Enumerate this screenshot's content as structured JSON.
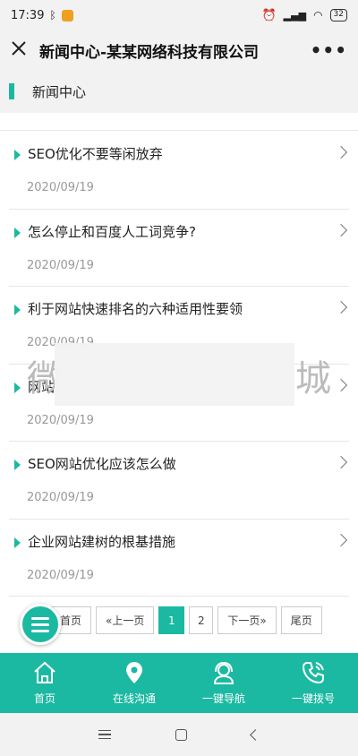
{
  "status_bar": {
    "time": "17:39",
    "battery": "32",
    "bluetooth_icon": "bluetooth-icon",
    "app_icon": "app-notification-icon"
  },
  "nav": {
    "title": "新闻中心-某某网络科技有限公司",
    "close_label": "×",
    "more_label": "•••"
  },
  "section": {
    "title": "新闻中心",
    "accent_color": "#1bb9a2"
  },
  "news": [
    {
      "title": "SEO优化不要等闲放弃",
      "date": "2020/09/19"
    },
    {
      "title": "怎么停止和百度人工词竞争?",
      "date": "2020/09/19"
    },
    {
      "title": "利于网站快速排名的六种适用性要领",
      "date": "2020/09/19"
    },
    {
      "title": "网站",
      "date": "2020/09/19"
    },
    {
      "title": "SEO网站优化应该怎么做",
      "date": "2020/09/19"
    },
    {
      "title": "企业网站建树的根基措施",
      "date": "2020/09/19"
    }
  ],
  "overlay": {
    "left_char": "微",
    "right_char": "城"
  },
  "pagination": {
    "first": "首页",
    "prev": "«上一页",
    "pages": [
      "1",
      "2"
    ],
    "current": "1",
    "next": "下一页»",
    "last": "尾页"
  },
  "tabs": [
    {
      "label": "首页",
      "icon": "home-icon"
    },
    {
      "label": "在线沟通",
      "icon": "location-pin-icon"
    },
    {
      "label": "一键导航",
      "icon": "headset-icon"
    },
    {
      "label": "一键拨号",
      "icon": "phone-icon"
    }
  ]
}
